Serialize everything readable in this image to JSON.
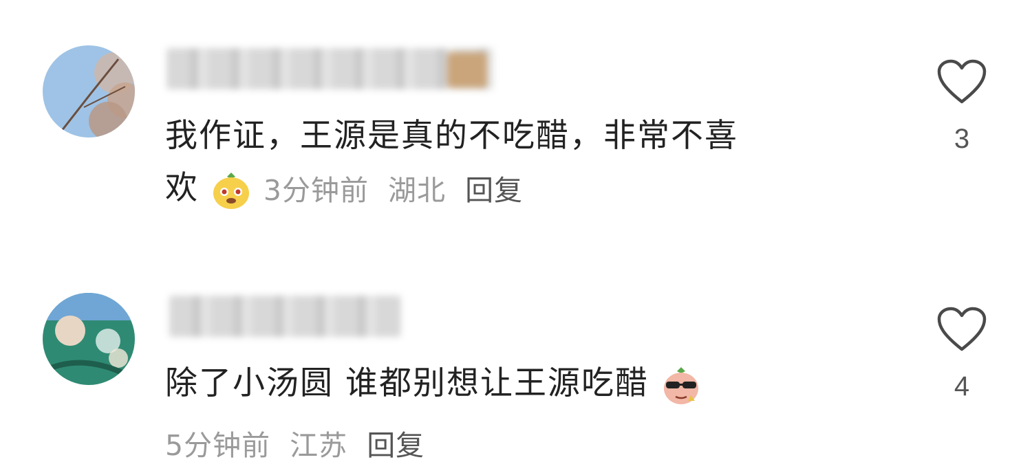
{
  "comments": [
    {
      "text_line1": "我作证，王源是真的不吃醋，非常不喜",
      "text_line2": "欢",
      "emoji": "yellow-face-emoji",
      "time": "3分钟前",
      "location": "湖北",
      "reply_label": "回复",
      "like_count": "3"
    },
    {
      "text_line1": "除了小汤圆 谁都别想让王源吃醋",
      "emoji": "sunglasses-face-emoji",
      "time": "5分钟前",
      "location": "江苏",
      "reply_label": "回复",
      "like_count": "4"
    }
  ],
  "icons": {
    "like": "heart-outline-icon"
  },
  "colors": {
    "text": "#222222",
    "meta": "#9a9a9a",
    "reply": "#555555"
  }
}
